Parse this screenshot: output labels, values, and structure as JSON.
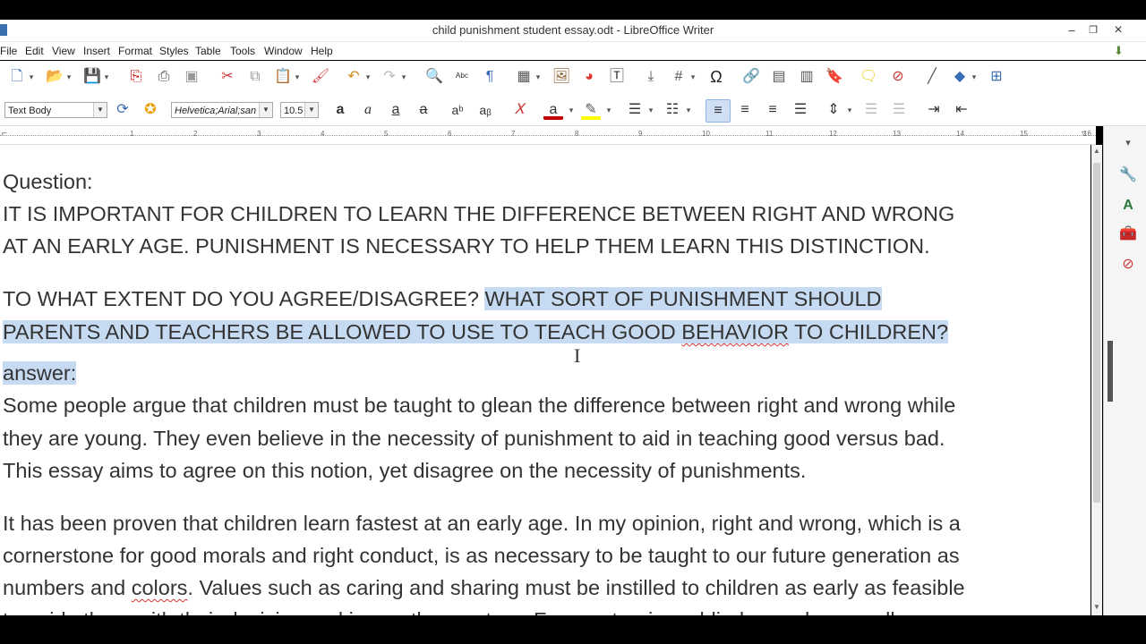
{
  "window": {
    "title": "child punishment student essay.odt - LibreOffice Writer",
    "controls": {
      "minimize": "–",
      "restore": "❐",
      "close": "×"
    }
  },
  "menu": [
    "File",
    "Edit",
    "View",
    "Insert",
    "Format",
    "Styles",
    "Table",
    "Tools",
    "Window",
    "Help"
  ],
  "formatting": {
    "paragraph_style": "Text Body",
    "font_name": "Helvetica;Arial;san",
    "font_size": "10.5",
    "active_alignment": "align-left"
  },
  "document": {
    "paragraphs": [
      {
        "segments": [
          {
            "text": "Question:"
          }
        ]
      },
      {
        "segments": [
          {
            "text": "IT IS IMPORTANT FOR CHILDREN TO LEARN THE DIFFERENCE BETWEEN RIGHT AND WRONG"
          }
        ]
      },
      {
        "segments": [
          {
            "text": "AT AN EARLY AGE. PUNISHMENT IS NECESSARY TO HELP THEM LEARN THIS DISTINCTION."
          }
        ]
      },
      {
        "segments": [
          {
            "text": "TO WHAT EXTENT DO YOU AGREE/DISAGREE? "
          },
          {
            "text": "WHAT SORT OF PUNISHMENT SHOULD",
            "selected": true
          }
        ]
      },
      {
        "segments": [
          {
            "text": "PARENTS AND TEACHERS BE ALLOWED TO USE TO TEACH GOOD ",
            "selected": true
          },
          {
            "text": "BEHAVIOR",
            "selected": true,
            "misspelled": true
          },
          {
            "text": " TO CHILDREN?",
            "selected": true
          }
        ]
      },
      {
        "segments": [
          {
            "text": "answer:",
            "selected": true
          }
        ]
      },
      {
        "segments": [
          {
            "text": "Some people argue that children must be taught to glean the difference between right and wrong while"
          }
        ]
      },
      {
        "segments": [
          {
            "text": "they are young. They even believe in the necessity of punishment to aid in teaching good versus bad."
          }
        ]
      },
      {
        "segments": [
          {
            "text": "This essay aims to agree on this notion, yet disagree on the necessity of punishments."
          }
        ]
      },
      {
        "segments": [
          {
            "text": "It has been proven that children learn fastest at an early age. In my opinion, right and wrong, which is a"
          }
        ]
      },
      {
        "segments": [
          {
            "text": "cornerstone for good morals and right conduct, is as necessary to be taught to our future generation as"
          }
        ]
      },
      {
        "segments": [
          {
            "text": "numbers and "
          },
          {
            "text": "colors",
            "misspelled": true
          },
          {
            "text": ". Values such as caring and sharing must be instilled to children as early as feasible"
          }
        ]
      },
      {
        "segments": [
          {
            "text": "to guide them with their decision making as they mature. For me, turning a blind eye when small"
          }
        ]
      }
    ]
  },
  "ruler_ticks": [
    "1",
    "2",
    "3",
    "4",
    "5",
    "6",
    "7",
    "8",
    "9",
    "10",
    "11",
    "12",
    "13",
    "14",
    "15",
    "16"
  ],
  "colors": {
    "selection": "#c6dbf1",
    "font_color_bar": "#c00000",
    "highlight_bar": "#ffff00"
  }
}
